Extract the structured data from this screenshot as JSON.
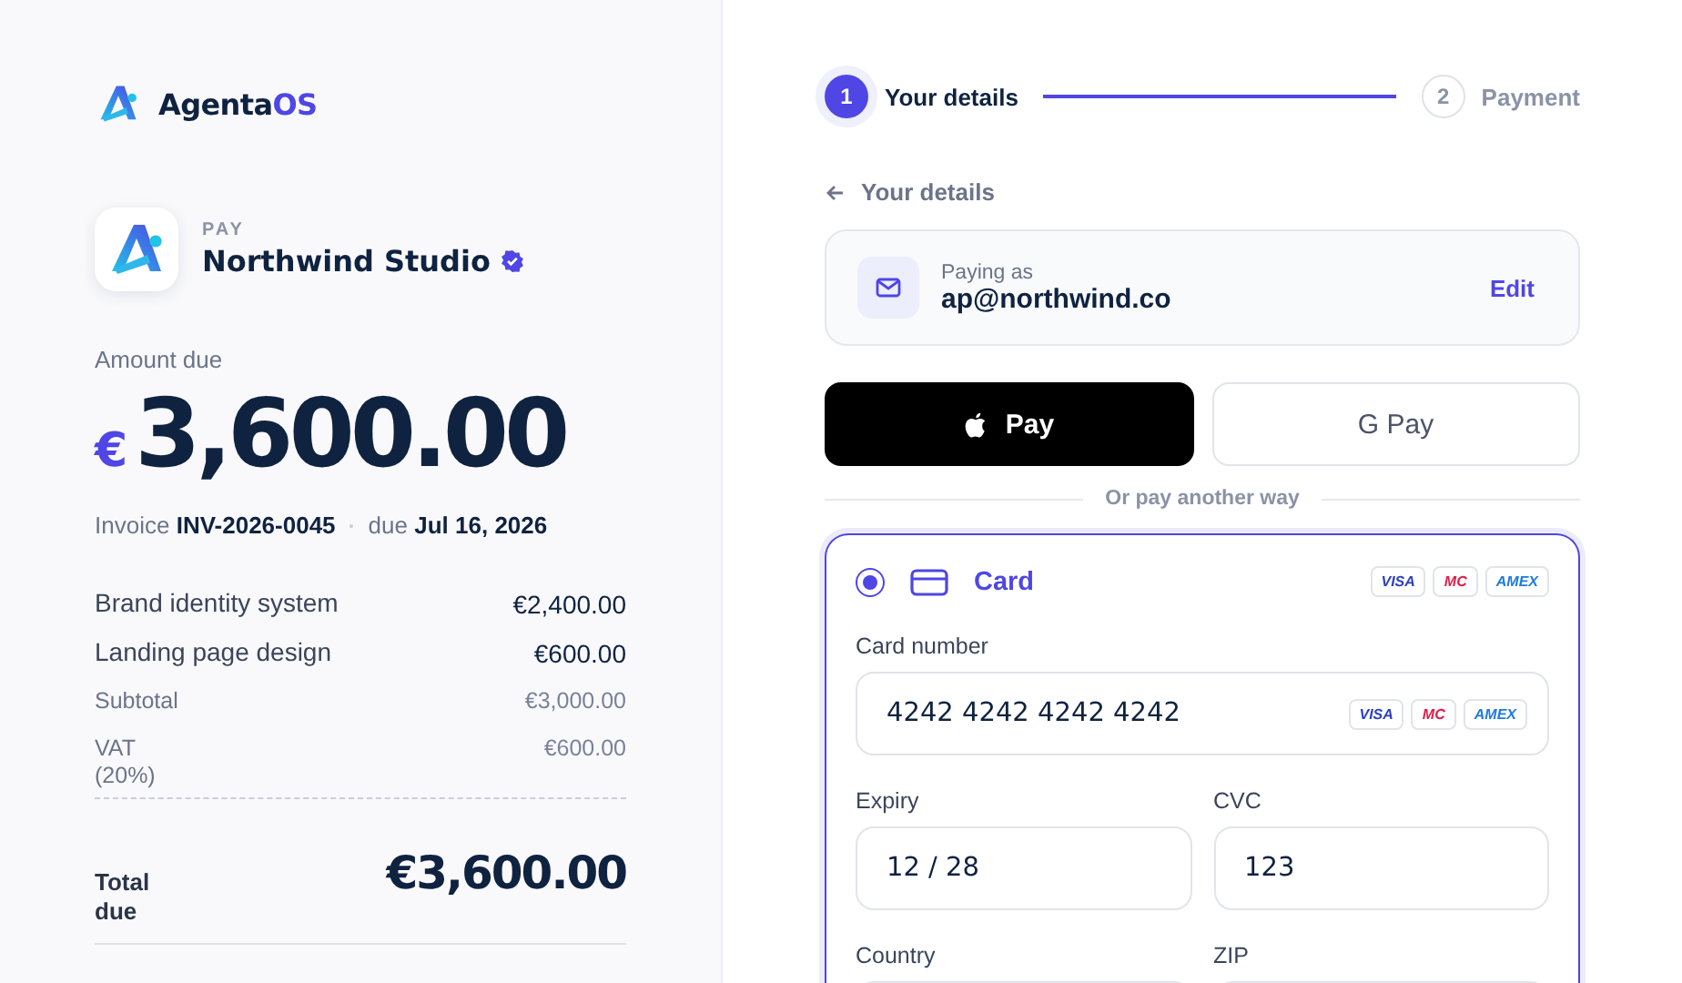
{
  "brand": {
    "name": "Agenta",
    "accent": "OS"
  },
  "merchant": {
    "eyebrow": "PAY",
    "name": "Northwind Studio",
    "verified": true
  },
  "amount": {
    "label": "Amount due",
    "currency": "€",
    "value": "3,600.00"
  },
  "invoice": {
    "label": "Invoice",
    "number": "INV-2026-0045",
    "due_label": "due",
    "due_date": "Jul 16, 2026"
  },
  "line_items": [
    {
      "label": "Brand identity system",
      "amount": "€2,400.00",
      "kind": "item"
    },
    {
      "label": "Landing page design",
      "amount": "€600.00",
      "kind": "item"
    },
    {
      "label": "Subtotal",
      "amount": "€3,000.00",
      "kind": "summary"
    },
    {
      "label": "VAT (20%)",
      "amount": "€600.00",
      "kind": "summary"
    }
  ],
  "total": {
    "label": "Total due",
    "amount": "€3,600.00"
  },
  "steps": [
    {
      "number": "1",
      "label": "Your details",
      "selected": true
    },
    {
      "number": "2",
      "label": "Payment",
      "selected": false
    }
  ],
  "back_link": "Your details",
  "payer": {
    "label": "Paying as",
    "email": "ap@northwind.co",
    "action": "Edit"
  },
  "wallets": [
    {
      "kind": "apple",
      "label": "Pay"
    },
    {
      "kind": "google",
      "label": "G Pay"
    }
  ],
  "divider": "Or pay another way",
  "method": {
    "label": "Card",
    "selected": true,
    "brands": [
      {
        "label": "VISA",
        "color": "#2b3fc4"
      },
      {
        "label": "MC",
        "color": "#e11d48"
      },
      {
        "label": "AMEX",
        "color": "#1d7be0"
      }
    ]
  },
  "card_number": {
    "label": "Card number",
    "value": "4242 4242 4242 4242",
    "brands": [
      {
        "label": "VISA",
        "color": "#2b3fc4"
      },
      {
        "label": "MC",
        "color": "#e11d48"
      },
      {
        "label": "AMEX",
        "color": "#1d7be0"
      }
    ]
  },
  "field_rows": [
    [
      {
        "label": "Expiry",
        "value": "12 / 28"
      },
      {
        "label": "CVC",
        "value": "123"
      }
    ],
    [
      {
        "label": "Country"
      },
      {
        "label": "ZIP"
      }
    ]
  ]
}
